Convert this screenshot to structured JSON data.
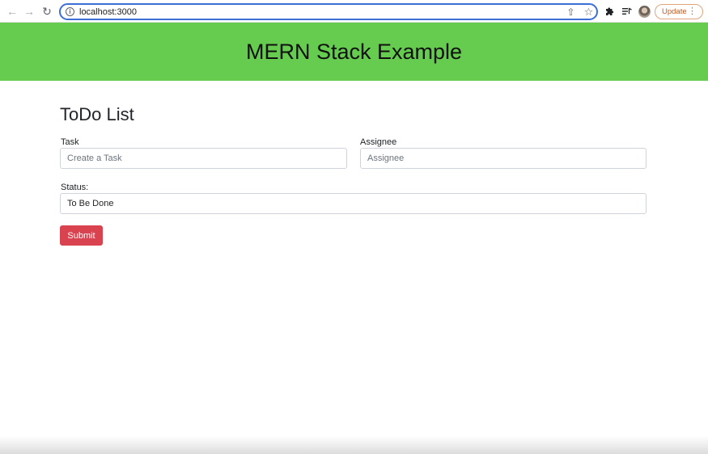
{
  "browser": {
    "url": "localhost:3000",
    "update_label": "Update",
    "icons": {
      "back": "arrow-left",
      "forward": "arrow-right",
      "reload": "reload",
      "info": "info-circle",
      "share": "share",
      "bookmark": "star",
      "extensions": "puzzle",
      "reading_list": "reading-list",
      "profile": "avatar",
      "menu": "vertical-dots"
    }
  },
  "header": {
    "title": "MERN Stack Example",
    "background_color": "#66cc4f"
  },
  "form": {
    "heading": "ToDo List",
    "task": {
      "label": "Task",
      "placeholder": "Create a Task",
      "value": ""
    },
    "assignee": {
      "label": "Assignee",
      "placeholder": "Assignee",
      "value": ""
    },
    "status": {
      "label": "Status:",
      "selected": "To Be Done"
    },
    "submit_label": "Submit",
    "submit_color": "#d9434f"
  }
}
